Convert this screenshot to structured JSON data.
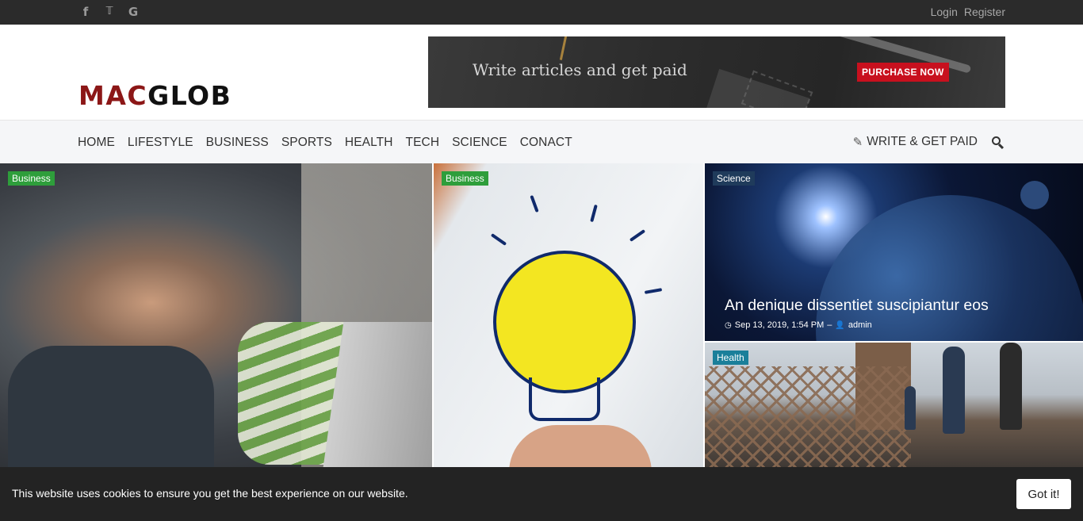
{
  "topbar": {
    "social": [
      {
        "icon": "facebook-icon",
        "glyph": "f"
      },
      {
        "icon": "twitter-icon",
        "glyph": "🐦"
      },
      {
        "icon": "google-icon",
        "glyph": "G"
      }
    ],
    "login_label": "Login",
    "register_label": "Register"
  },
  "header": {
    "logo_part1": "MAC",
    "logo_part2": "GLOB",
    "logo_color_accent": "#8c1717",
    "banner_text": "Write articles and get paid",
    "banner_button": "PURCHASE NOW",
    "banner_button_color": "#c8101e"
  },
  "nav": {
    "items": [
      "HOME",
      "LIFESTYLE",
      "BUSINESS",
      "SPORTS",
      "HEALTH",
      "TECH",
      "SCIENCE",
      "CONACT"
    ],
    "write_label": "WRITE & GET PAID"
  },
  "posts": [
    {
      "category": "Business",
      "category_color": "#2e9e3b"
    },
    {
      "category": "Business",
      "category_color": "#2e9e3b"
    },
    {
      "category": "Science",
      "category_color": "#1f3b5b",
      "title": "An denique dissentiet suscipiantur eos",
      "date": "Sep 13, 2019, 1:54 PM",
      "separator": "–",
      "author": "admin"
    },
    {
      "category": "Health",
      "category_color": "#1a7f9a"
    }
  ],
  "cookie": {
    "message": "This website uses cookies to ensure you get the best experience on our website.",
    "button": "Got it!"
  }
}
